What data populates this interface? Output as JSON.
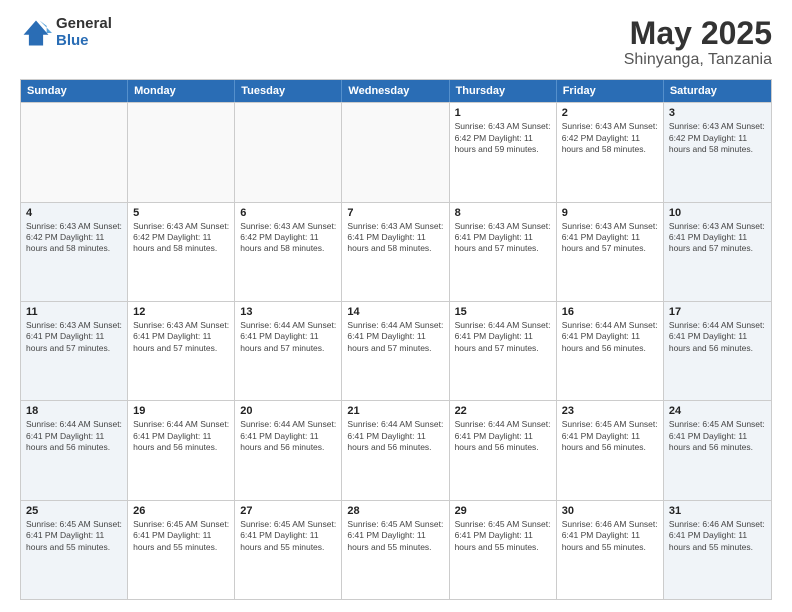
{
  "logo": {
    "general": "General",
    "blue": "Blue"
  },
  "header": {
    "title": "May 2025",
    "subtitle": "Shinyanga, Tanzania"
  },
  "weekdays": [
    "Sunday",
    "Monday",
    "Tuesday",
    "Wednesday",
    "Thursday",
    "Friday",
    "Saturday"
  ],
  "weeks": [
    [
      {
        "day": "",
        "info": "",
        "empty": true
      },
      {
        "day": "",
        "info": "",
        "empty": true
      },
      {
        "day": "",
        "info": "",
        "empty": true
      },
      {
        "day": "",
        "info": "",
        "empty": true
      },
      {
        "day": "1",
        "info": "Sunrise: 6:43 AM\nSunset: 6:42 PM\nDaylight: 11 hours\nand 59 minutes."
      },
      {
        "day": "2",
        "info": "Sunrise: 6:43 AM\nSunset: 6:42 PM\nDaylight: 11 hours\nand 58 minutes."
      },
      {
        "day": "3",
        "info": "Sunrise: 6:43 AM\nSunset: 6:42 PM\nDaylight: 11 hours\nand 58 minutes."
      }
    ],
    [
      {
        "day": "4",
        "info": "Sunrise: 6:43 AM\nSunset: 6:42 PM\nDaylight: 11 hours\nand 58 minutes."
      },
      {
        "day": "5",
        "info": "Sunrise: 6:43 AM\nSunset: 6:42 PM\nDaylight: 11 hours\nand 58 minutes."
      },
      {
        "day": "6",
        "info": "Sunrise: 6:43 AM\nSunset: 6:42 PM\nDaylight: 11 hours\nand 58 minutes."
      },
      {
        "day": "7",
        "info": "Sunrise: 6:43 AM\nSunset: 6:41 PM\nDaylight: 11 hours\nand 58 minutes."
      },
      {
        "day": "8",
        "info": "Sunrise: 6:43 AM\nSunset: 6:41 PM\nDaylight: 11 hours\nand 57 minutes."
      },
      {
        "day": "9",
        "info": "Sunrise: 6:43 AM\nSunset: 6:41 PM\nDaylight: 11 hours\nand 57 minutes."
      },
      {
        "day": "10",
        "info": "Sunrise: 6:43 AM\nSunset: 6:41 PM\nDaylight: 11 hours\nand 57 minutes."
      }
    ],
    [
      {
        "day": "11",
        "info": "Sunrise: 6:43 AM\nSunset: 6:41 PM\nDaylight: 11 hours\nand 57 minutes."
      },
      {
        "day": "12",
        "info": "Sunrise: 6:43 AM\nSunset: 6:41 PM\nDaylight: 11 hours\nand 57 minutes."
      },
      {
        "day": "13",
        "info": "Sunrise: 6:44 AM\nSunset: 6:41 PM\nDaylight: 11 hours\nand 57 minutes."
      },
      {
        "day": "14",
        "info": "Sunrise: 6:44 AM\nSunset: 6:41 PM\nDaylight: 11 hours\nand 57 minutes."
      },
      {
        "day": "15",
        "info": "Sunrise: 6:44 AM\nSunset: 6:41 PM\nDaylight: 11 hours\nand 57 minutes."
      },
      {
        "day": "16",
        "info": "Sunrise: 6:44 AM\nSunset: 6:41 PM\nDaylight: 11 hours\nand 56 minutes."
      },
      {
        "day": "17",
        "info": "Sunrise: 6:44 AM\nSunset: 6:41 PM\nDaylight: 11 hours\nand 56 minutes."
      }
    ],
    [
      {
        "day": "18",
        "info": "Sunrise: 6:44 AM\nSunset: 6:41 PM\nDaylight: 11 hours\nand 56 minutes."
      },
      {
        "day": "19",
        "info": "Sunrise: 6:44 AM\nSunset: 6:41 PM\nDaylight: 11 hours\nand 56 minutes."
      },
      {
        "day": "20",
        "info": "Sunrise: 6:44 AM\nSunset: 6:41 PM\nDaylight: 11 hours\nand 56 minutes."
      },
      {
        "day": "21",
        "info": "Sunrise: 6:44 AM\nSunset: 6:41 PM\nDaylight: 11 hours\nand 56 minutes."
      },
      {
        "day": "22",
        "info": "Sunrise: 6:44 AM\nSunset: 6:41 PM\nDaylight: 11 hours\nand 56 minutes."
      },
      {
        "day": "23",
        "info": "Sunrise: 6:45 AM\nSunset: 6:41 PM\nDaylight: 11 hours\nand 56 minutes."
      },
      {
        "day": "24",
        "info": "Sunrise: 6:45 AM\nSunset: 6:41 PM\nDaylight: 11 hours\nand 56 minutes."
      }
    ],
    [
      {
        "day": "25",
        "info": "Sunrise: 6:45 AM\nSunset: 6:41 PM\nDaylight: 11 hours\nand 55 minutes."
      },
      {
        "day": "26",
        "info": "Sunrise: 6:45 AM\nSunset: 6:41 PM\nDaylight: 11 hours\nand 55 minutes."
      },
      {
        "day": "27",
        "info": "Sunrise: 6:45 AM\nSunset: 6:41 PM\nDaylight: 11 hours\nand 55 minutes."
      },
      {
        "day": "28",
        "info": "Sunrise: 6:45 AM\nSunset: 6:41 PM\nDaylight: 11 hours\nand 55 minutes."
      },
      {
        "day": "29",
        "info": "Sunrise: 6:45 AM\nSunset: 6:41 PM\nDaylight: 11 hours\nand 55 minutes."
      },
      {
        "day": "30",
        "info": "Sunrise: 6:46 AM\nSunset: 6:41 PM\nDaylight: 11 hours\nand 55 minutes."
      },
      {
        "day": "31",
        "info": "Sunrise: 6:46 AM\nSunset: 6:41 PM\nDaylight: 11 hours\nand 55 minutes."
      }
    ]
  ]
}
